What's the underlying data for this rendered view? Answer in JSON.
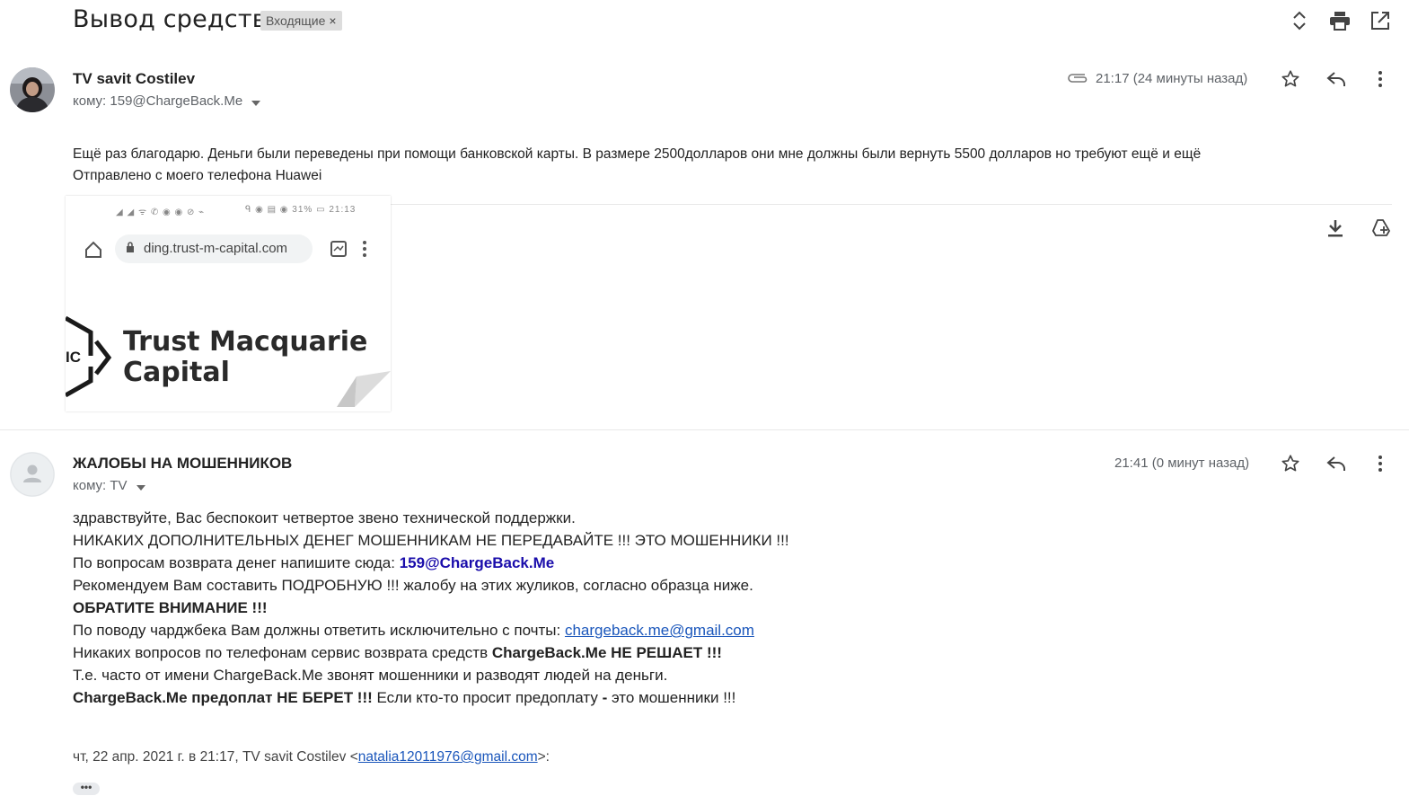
{
  "thread": {
    "subject": "Вывод средств",
    "label": "Входящие",
    "label_close": "×"
  },
  "toolbar_icons": [
    "expand-collapse-icon",
    "print-icon",
    "open-in-new-window-icon"
  ],
  "message1": {
    "sender": "TV savit Costilev",
    "to_line": "кому: 159@ChargeBack.Me",
    "time": "21:17 (24 минуты назад)",
    "body_line1": "Ещё раз благодарю. Деньги были переведены при помощи банковской карты. В размере 2500долларов они мне должны были вернуть 5500 долларов  но требуют ещё и ещё",
    "body_line2": "Отправлено с моего телефона Huawei",
    "attachment": {
      "status_left": "◢ ◢ ᯤ ✆ ◉ ◉ ⊘ ⌁",
      "status_right": "ᑫ ◉ ▤ ◉ 31% ▭ 21:13",
      "url": "ding.trust-m-capital.com",
      "logo_line1": "Trust Macquarie",
      "logo_line2": "Capital",
      "logo_mark": "IC"
    }
  },
  "message2": {
    "sender": "ЖАЛОБЫ НА МОШЕННИКОВ",
    "to_line": "кому: TV",
    "time": "21:41 (0 минут назад)",
    "l1": "здравствуйте, Вас беспокоит четвертое звено технической поддержки.",
    "l2": "НИКАКИХ ДОПОЛНИТЕЛЬНЫХ ДЕНЕГ МОШЕННИКАМ НЕ ПЕРЕДАВАЙТЕ !!! ЭТО МОШЕННИКИ !!!",
    "l3a": "По вопросам возврата денег напишите сюда: ",
    "l3b": "159@ChargeBack.Me",
    "l4": "Рекомендуем Вам составить ПОДРОБНУЮ !!! жалобу на этих жуликов, согласно образца ниже.",
    "l5": "ОБРАТИТЕ ВНИМАНИЕ !!!",
    "l6a": "По поводу чарджбека Вам должны ответить исключительно с почты: ",
    "l6b": "chargeback.me@gmail.com",
    "l7a": "Никаких вопросов по телефонам сервис возврата средств ",
    "l7b": "ChargeBack.Me НЕ РЕШАЕТ !!!",
    "l8": "Т.е. часто от имени ChargeBack.Me звонят мошенники и разводят людей на деньги.",
    "l9a": "ChargeBack.Me предоплат НЕ БЕРЕТ !!!",
    "l9b": " Если кто-то просит предоплату ",
    "l9c": "-",
    "l9d": " это мошенники !!!",
    "quote_a": "чт, 22 апр. 2021 г. в 21:17, TV savit Costilev <",
    "quote_email": "natalia12011976@gmail.com",
    "quote_b": ">:",
    "ellipsis": "•••"
  }
}
